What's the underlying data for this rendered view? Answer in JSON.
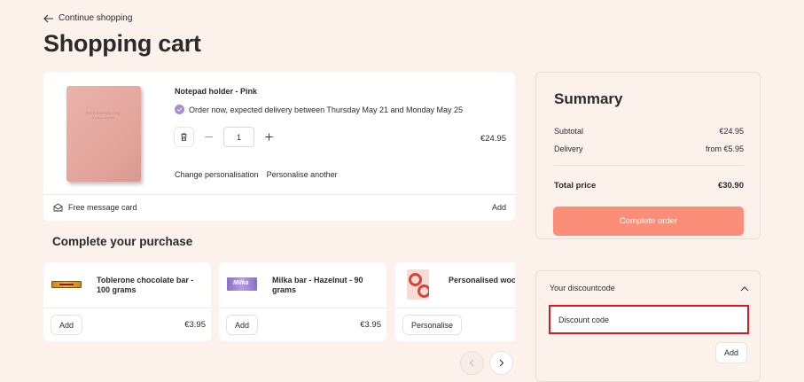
{
  "nav": {
    "back_label": "Continue shopping"
  },
  "page": {
    "title": "Shopping cart"
  },
  "cart": {
    "item": {
      "image_caption_1": "PERSONALISE",
      "image_caption_2": "NAME HERE",
      "name": "Notepad holder - Pink",
      "delivery": "Order now, expected delivery between Thursday May 21 and Monday May 25",
      "quantity": "1",
      "price": "€24.95",
      "change_personalisation": "Change personalisation",
      "personalise_another": "Personalise another"
    },
    "message_card": {
      "label": "Free message card",
      "action": "Add"
    }
  },
  "recommendations": {
    "title": "Complete your purchase",
    "items": [
      {
        "name": "Toblerone chocolate bar - 100 grams",
        "button": "Add",
        "price": "€3.95"
      },
      {
        "name": "Milka bar - Hazelnut - 90 grams",
        "button": "Add",
        "price": "€3.95",
        "brand": "Milka"
      },
      {
        "name": "Personalised wood Love",
        "button": "Personalise",
        "price": ""
      }
    ]
  },
  "summary": {
    "title": "Summary",
    "subtotal_label": "Subtotal",
    "subtotal_value": "€24.95",
    "delivery_label": "Delivery",
    "delivery_value": "from €5.95",
    "total_label": "Total price",
    "total_value": "€30.90",
    "cta": "Complete order"
  },
  "discount": {
    "title": "Your discountcode",
    "placeholder": "Discount code",
    "add": "Add"
  },
  "colors": {
    "background": "#fdf1ec",
    "cta": "#fa8e78",
    "check": "#a98bd4",
    "highlight": "#e3161d"
  }
}
